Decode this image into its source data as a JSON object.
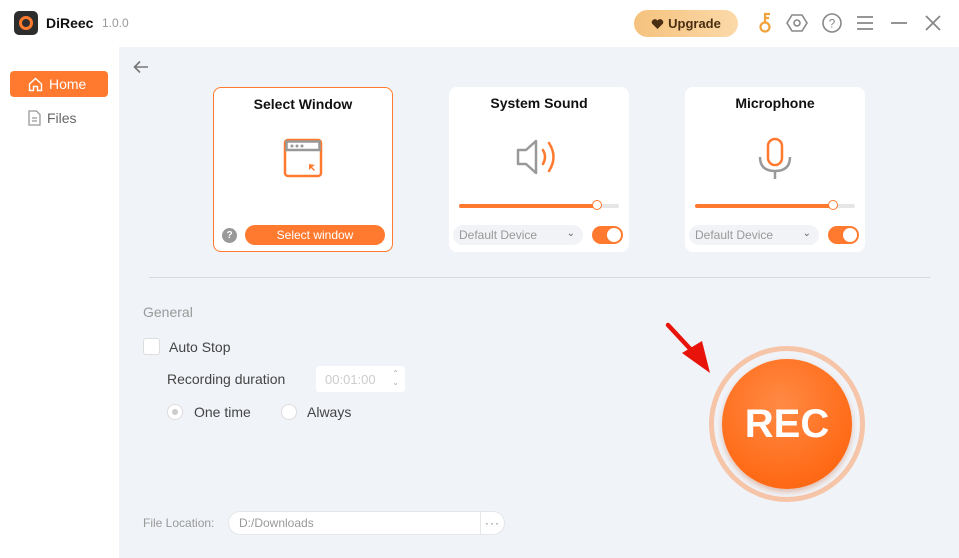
{
  "app": {
    "name": "DiReec",
    "version": "1.0.0"
  },
  "titlebar": {
    "upgrade_label": "Upgrade",
    "icons": [
      "key-icon",
      "settings-icon",
      "help-icon",
      "menu-icon",
      "minimize-icon",
      "close-icon"
    ]
  },
  "sidebar": {
    "items": [
      {
        "label": "Home",
        "icon": "home-icon",
        "active": true
      },
      {
        "label": "Files",
        "icon": "file-icon",
        "active": false
      }
    ]
  },
  "cards": {
    "select_window": {
      "title": "Select Window",
      "button_label": "Select window",
      "help": "?"
    },
    "system_sound": {
      "title": "System Sound",
      "volume_percent": 86,
      "device": "Default Device",
      "enabled": true
    },
    "microphone": {
      "title": "Microphone",
      "volume_percent": 86,
      "device": "Default Device",
      "enabled": true
    }
  },
  "general": {
    "section_label": "General",
    "auto_stop_label": "Auto Stop",
    "auto_stop_checked": false,
    "recording_duration_label": "Recording duration",
    "recording_duration_value": "00:01:00",
    "radio_options": [
      {
        "label": "One time",
        "checked": true
      },
      {
        "label": "Always",
        "checked": false
      }
    ]
  },
  "rec_button_label": "REC",
  "file_location": {
    "label": "File Location:",
    "value": "D:/Downloads",
    "browse_label": "···"
  },
  "colors": {
    "accent": "#ff7a2f",
    "background": "#f0f3f8"
  }
}
